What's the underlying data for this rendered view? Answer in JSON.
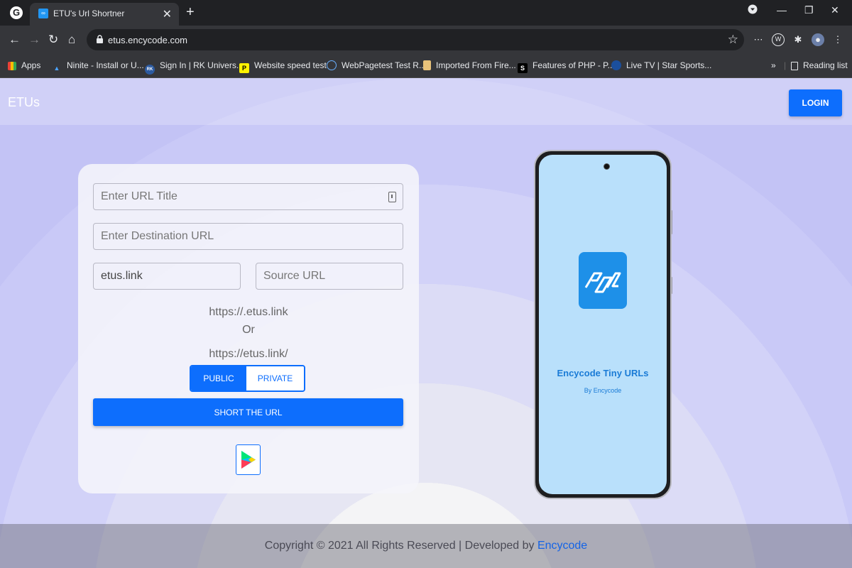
{
  "browser": {
    "tab_title": "ETU's Url Shortner",
    "url": "etus.encycode.com",
    "bookmarks": [
      {
        "label": "Apps",
        "icon": "apps-grid-icon"
      },
      {
        "label": "Ninite - Install or U...",
        "icon": "ninite-icon"
      },
      {
        "label": "Sign In | RK Univers...",
        "icon": "rku-icon"
      },
      {
        "label": "Website speed test",
        "icon": "pingdom-icon"
      },
      {
        "label": "WebPagetest Test R...",
        "icon": "webpagetest-icon"
      },
      {
        "label": "Imported From Fire...",
        "icon": "folder-icon"
      },
      {
        "label": "Features of PHP - P...",
        "icon": "scaler-icon"
      },
      {
        "label": "Live TV | Star Sports...",
        "icon": "hotstar-icon"
      }
    ],
    "overflow": "»",
    "reading_list": "Reading list"
  },
  "header": {
    "brand": "ETUs",
    "login_label": "LOGIN"
  },
  "form": {
    "title_placeholder": "Enter URL Title",
    "destination_placeholder": "Enter Destination URL",
    "domain_value": "etus.link",
    "source_placeholder": "Source URL",
    "preview_line1": "https://.etus.link",
    "preview_or": "Or",
    "preview_line2": "https://etus.link/",
    "public_label": "PUBLIC",
    "private_label": "PRIVATE",
    "submit_label": "SHORT THE URL"
  },
  "phone": {
    "app_name": "Encycode Tiny URLs",
    "app_by": "By Encycode"
  },
  "footer": {
    "text": "Copyright © 2021 All Rights Reserved | Developed by ",
    "link": "Encycode"
  },
  "colors": {
    "primary": "#0d6efd",
    "page_bg": "#c9c9f7",
    "app_icon": "#1e90e8"
  }
}
